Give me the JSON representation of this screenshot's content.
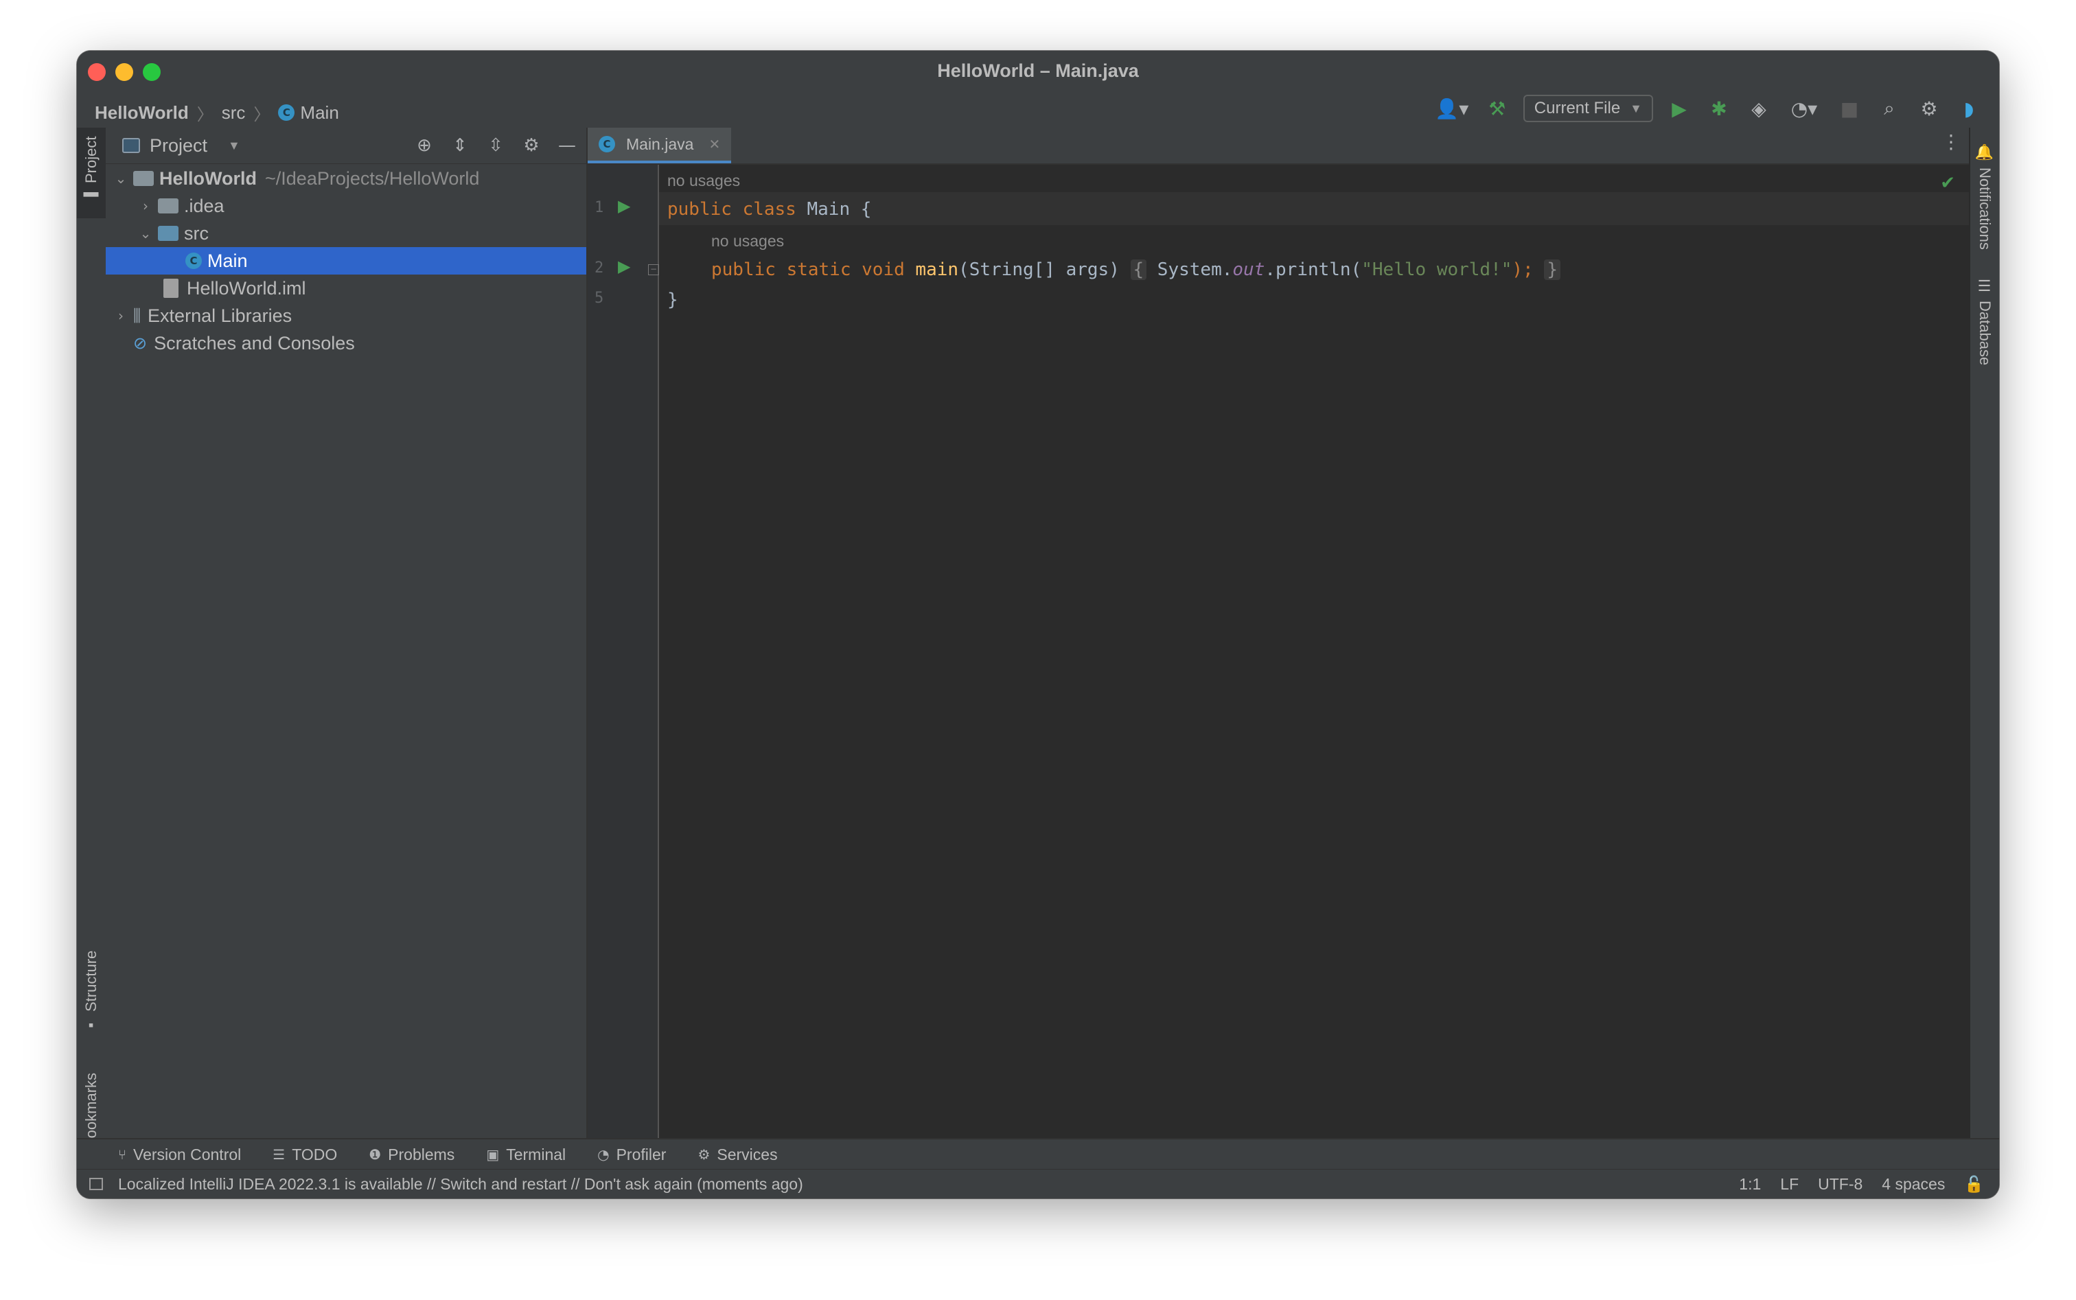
{
  "window": {
    "title": "HelloWorld – Main.java"
  },
  "breadcrumb": {
    "project": "HelloWorld",
    "folder": "src",
    "file": "Main"
  },
  "toolbar": {
    "run_config": "Current File"
  },
  "left_stripe": {
    "project": "Project",
    "structure": "Structure",
    "bookmarks": "Bookmarks"
  },
  "right_stripe": {
    "notifications": "Notifications",
    "database": "Database"
  },
  "project_panel": {
    "title": "Project",
    "tree": [
      {
        "label": "HelloWorld",
        "path": "~/IdeaProjects/HelloWorld"
      },
      {
        "label": ".idea"
      },
      {
        "label": "src"
      },
      {
        "label": "Main"
      },
      {
        "label": "HelloWorld.iml"
      },
      {
        "label": "External Libraries"
      },
      {
        "label": "Scratches and Consoles"
      }
    ]
  },
  "editor": {
    "tab_label": "Main.java",
    "usage_hint_1": "no usages",
    "usage_hint_2": "no usages",
    "line_numbers": [
      "1",
      "2",
      "5"
    ],
    "code": {
      "l1_kw": "public class ",
      "l1_name": "Main {",
      "l2_kw": "public static void ",
      "l2_fn": "main",
      "l2_args": "(String[] args) ",
      "l2_open": "{",
      "l2_sys": " System.",
      "l2_out": "out",
      "l2_call": ".println(",
      "l2_str": "\"Hello world!\"",
      "l2_end": ");",
      "l2_close": "}",
      "l5": "}"
    }
  },
  "bottom_tools": [
    "Version Control",
    "TODO",
    "Problems",
    "Terminal",
    "Profiler",
    "Services"
  ],
  "status": {
    "message": "Localized IntelliJ IDEA 2022.3.1 is available // Switch and restart // Don't ask again (moments ago)",
    "position": "1:1",
    "line_ending": "LF",
    "encoding": "UTF-8",
    "indent": "4 spaces"
  },
  "colors": {
    "accent": "#2f65ca",
    "run_green": "#499c54",
    "keyword": "#cc7832",
    "string": "#6a8759"
  }
}
